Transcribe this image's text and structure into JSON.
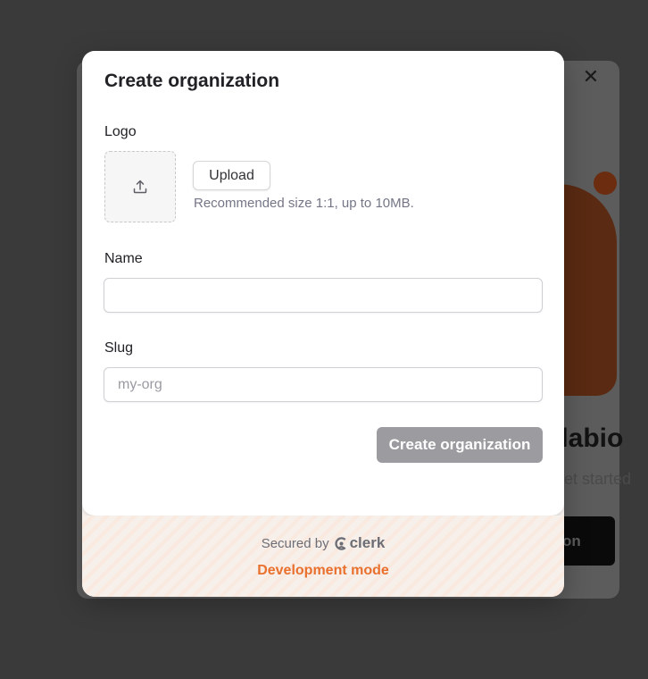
{
  "background": {
    "close_icon": "close-icon",
    "heading_fragment": "llabio",
    "subtitle_fragment": "get started",
    "button_fragment": "on"
  },
  "modal": {
    "title": "Create organization",
    "logo": {
      "label": "Logo",
      "icon": "upload-icon",
      "upload_label": "Upload",
      "hint": "Recommended size 1:1, up to 10MB."
    },
    "name": {
      "label": "Name",
      "value": "",
      "placeholder": ""
    },
    "slug": {
      "label": "Slug",
      "value": "",
      "placeholder": "my-org"
    },
    "submit_label": "Create organization",
    "footer": {
      "secured_by": "Secured by",
      "brand": "clerk",
      "mode": "Development mode"
    }
  },
  "colors": {
    "overlay": "#3a3a3a",
    "accent_orange": "#e9702d",
    "disabled_button": "#9c9ca0"
  }
}
